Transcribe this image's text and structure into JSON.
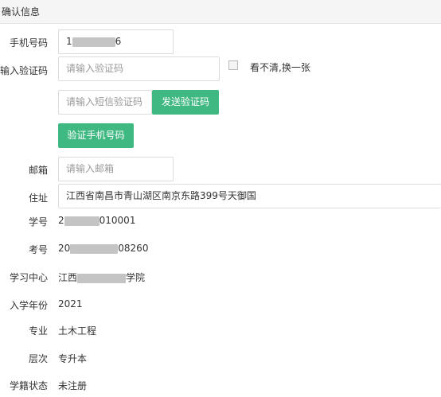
{
  "header": {
    "title": "确认信息"
  },
  "form": {
    "phone": {
      "label": "手机号码",
      "value_prefix": "1",
      "value_suffix": "6"
    },
    "captcha": {
      "label": "请输入验证码",
      "placeholder": "请输入验证码",
      "refresh_text": "看不清,换一张"
    },
    "sms": {
      "placeholder": "请输入短信验证码",
      "send_button": "发送验证码"
    },
    "verify_button": "验证手机号码",
    "email": {
      "label": "邮箱",
      "placeholder": "请输入邮箱"
    },
    "address": {
      "label": "住址",
      "value": "江西省南昌市青山湖区南京东路399号天御国"
    }
  },
  "info": {
    "student_no": {
      "label": "学号",
      "value_prefix": "2",
      "value_suffix": "010001"
    },
    "exam_no": {
      "label": "考号",
      "value_prefix": "20",
      "value_suffix": "08260"
    },
    "center": {
      "label": "学习中心",
      "value_prefix": "江西",
      "value_suffix": "学院"
    },
    "year": {
      "label": "入学年份",
      "value": "2021"
    },
    "major": {
      "label": "专业",
      "value": "土木工程"
    },
    "level": {
      "label": "层次",
      "value": "专升本"
    },
    "status": {
      "label": "学籍状态",
      "value": "未注册"
    }
  },
  "colors": {
    "accent": "#40b882",
    "header_bg": "#f5f5f5",
    "border": "#dcdcdc"
  }
}
